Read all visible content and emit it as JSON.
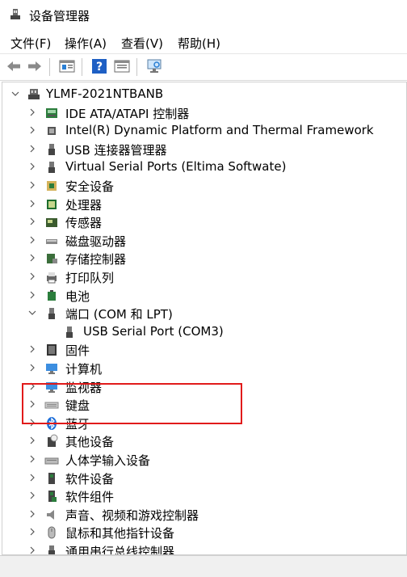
{
  "window": {
    "title": "设备管理器"
  },
  "menu": {
    "file": "文件(F)",
    "action": "操作(A)",
    "view": "查看(V)",
    "help": "帮助(H)"
  },
  "tree": {
    "root": "YLMF-2021NTBANB",
    "categories": [
      "IDE ATA/ATAPI 控制器",
      "Intel(R) Dynamic Platform and Thermal Framework",
      "USB 连接器管理器",
      "Virtual Serial Ports (Eltima Softwate)",
      "安全设备",
      "处理器",
      "传感器",
      "磁盘驱动器",
      "存储控制器",
      "打印队列",
      "电池",
      "端口 (COM 和 LPT)",
      "固件",
      "计算机",
      "监视器",
      "键盘",
      "蓝牙",
      "其他设备",
      "人体学输入设备",
      "软件设备",
      "软件组件",
      "声音、视频和游戏控制器",
      "鼠标和其他指针设备",
      "通用串行总线控制器"
    ],
    "expanded_child": "USB Serial Port (COM3)"
  },
  "colors": {
    "highlight_border": "#e11b1b",
    "selection": "#cce8ff"
  }
}
